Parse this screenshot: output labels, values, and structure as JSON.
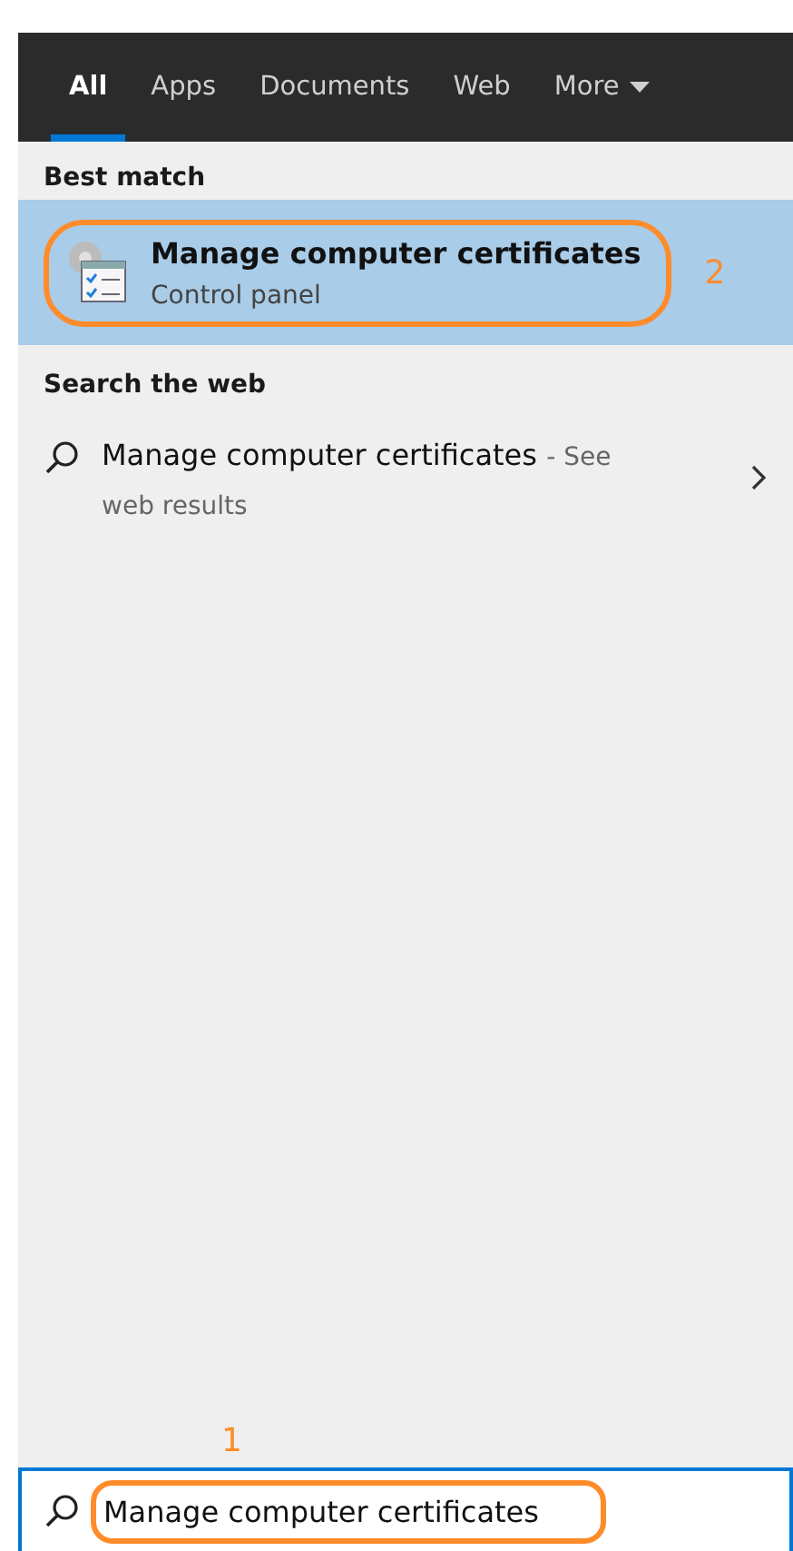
{
  "tabs": [
    {
      "label": "All",
      "selected": true
    },
    {
      "label": "Apps",
      "selected": false
    },
    {
      "label": "Documents",
      "selected": false
    },
    {
      "label": "Web",
      "selected": false
    },
    {
      "label": "More",
      "selected": false,
      "kind": "dropdown"
    }
  ],
  "best_match": {
    "heading": "Best match",
    "result": {
      "title": "Manage computer certificates",
      "subtitle": "Control panel",
      "selected": true
    },
    "annotation": "2"
  },
  "search_web": {
    "heading": "Search the web",
    "result": {
      "title": "Manage computer certificates",
      "suffix": "- See",
      "second_line": "web results"
    }
  },
  "search_box": {
    "annotation": "1",
    "value": "Manage computer certificates"
  }
}
